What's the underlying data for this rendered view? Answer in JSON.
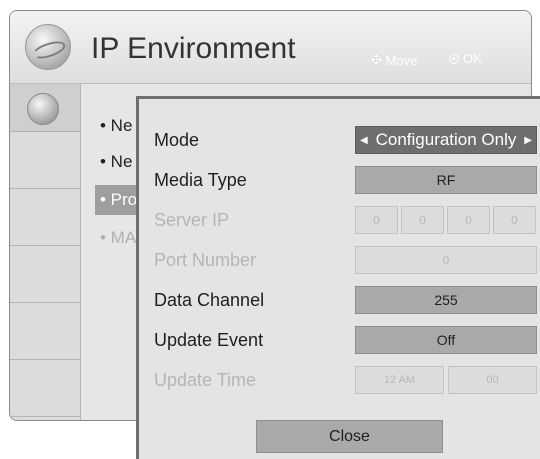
{
  "header": {
    "title": "IP Environment",
    "hints": {
      "move": "Move",
      "ok": "OK"
    }
  },
  "menu": {
    "items": [
      {
        "label": "• Ne",
        "state": "normal"
      },
      {
        "label": "• Ne",
        "state": "normal"
      },
      {
        "label": "• Pro",
        "state": "selected"
      },
      {
        "label": "• MA",
        "state": "disabled"
      }
    ]
  },
  "dialog": {
    "mode": {
      "label": "Mode",
      "value": "Configuration Only"
    },
    "media_type": {
      "label": "Media Type",
      "value": "RF"
    },
    "server_ip": {
      "label": "Server IP",
      "octets": [
        "0",
        "0",
        "0",
        "0"
      ]
    },
    "port_number": {
      "label": "Port Number",
      "value": "0"
    },
    "data_channel": {
      "label": "Data Channel",
      "value": "255"
    },
    "update_event": {
      "label": "Update Event",
      "value": "Off"
    },
    "update_time": {
      "label": "Update Time",
      "hour": "12 AM",
      "minute": "00"
    },
    "close_label": "Close"
  },
  "icons": {
    "header": "globe-icon",
    "sidebar": "globe-icon",
    "move": "directional-pad-icon",
    "ok": "ok-button-icon"
  },
  "colors": {
    "selected_bg": "#6e6e6e",
    "control_bg": "#a9a9a9",
    "disabled_text": "#b5b5b5"
  }
}
